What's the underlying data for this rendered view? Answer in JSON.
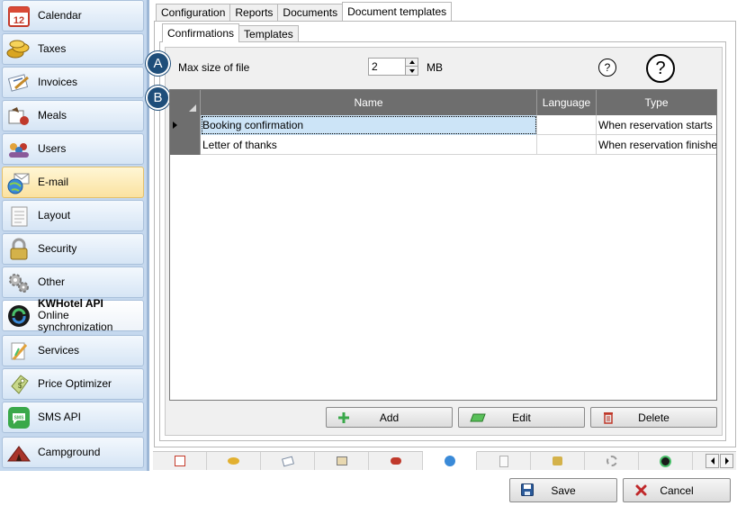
{
  "sidebar": {
    "items": [
      {
        "label": "Calendar",
        "icon": "calendar-icon"
      },
      {
        "label": "Taxes",
        "icon": "coins-icon"
      },
      {
        "label": "Invoices",
        "icon": "invoice-icon"
      },
      {
        "label": "Meals",
        "icon": "meals-icon"
      },
      {
        "label": "Users",
        "icon": "users-icon"
      },
      {
        "label": "E-mail",
        "icon": "email-globe-icon"
      },
      {
        "label": "Layout",
        "icon": "layout-icon"
      },
      {
        "label": "Security",
        "icon": "lock-icon"
      },
      {
        "label": "Other",
        "icon": "gears-icon"
      },
      {
        "label": "KWHotel API",
        "sublabel": "Online synchronization",
        "icon": "sync-icon"
      },
      {
        "label": "Services",
        "icon": "services-icon"
      },
      {
        "label": "Price Optimizer",
        "icon": "price-tag-icon"
      },
      {
        "label": "SMS API",
        "icon": "sms-icon"
      },
      {
        "label": "Campground",
        "icon": "campground-icon"
      }
    ],
    "active_index": 5
  },
  "tabs": {
    "main": [
      "Configuration",
      "Reports",
      "Documents",
      "Document templates"
    ],
    "sub": [
      "Confirmations",
      "Templates"
    ]
  },
  "badges": {
    "a": "A",
    "b": "B"
  },
  "file_size": {
    "label": "Max size of file",
    "value": "2",
    "unit": "MB",
    "help_small": "?",
    "help_large": "?"
  },
  "grid": {
    "columns": [
      "Name",
      "Language",
      "Type"
    ],
    "rows": [
      {
        "name": "Booking confirmation",
        "language": "",
        "type": "When reservation starts"
      },
      {
        "name": "Letter of thanks",
        "language": "",
        "type": "When reservation finishes"
      }
    ]
  },
  "buttons": {
    "add": "Add",
    "edit": "Edit",
    "delete": "Delete",
    "save": "Save",
    "cancel": "Cancel"
  },
  "colors": {
    "accent": "#1f4e7a",
    "active_sidebar": "#fbe2a0",
    "grid_header": "#6e6e6e",
    "selected_cell": "#cce4f7"
  }
}
